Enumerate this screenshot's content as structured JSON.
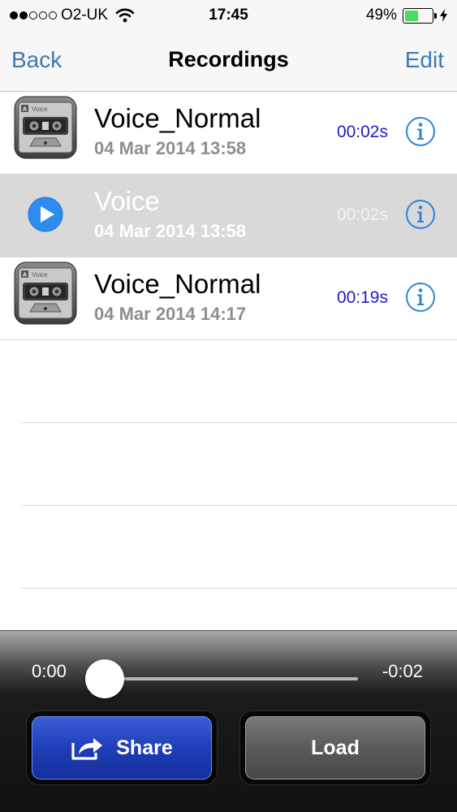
{
  "status_bar": {
    "carrier": "O2-UK",
    "time": "17:45",
    "battery_percent": "49%",
    "battery_level": 0.49,
    "signal_strength": 2,
    "signal_max": 5,
    "battery_color": "#4cd964"
  },
  "nav": {
    "back_label": "Back",
    "title": "Recordings",
    "edit_label": "Edit",
    "tint_color": "#3d7ab0"
  },
  "recordings": [
    {
      "title": "Voice_Normal",
      "date": "04 Mar 2014 13:58",
      "duration": "00:02s",
      "icon": "cassette-icon",
      "selected": false
    },
    {
      "title": "Voice",
      "date": "04 Mar 2014 13:58",
      "duration": "00:02s",
      "icon": "play-icon",
      "selected": true
    },
    {
      "title": "Voice_Normal",
      "date": "04 Mar 2014 14:17",
      "duration": "00:19s",
      "icon": "cassette-icon",
      "selected": false
    }
  ],
  "cassette_label": "Voice",
  "player": {
    "elapsed": "0:00",
    "remaining": "-0:02",
    "progress": 0.0,
    "share_label": "Share",
    "load_label": "Load"
  },
  "icons": {
    "info": "info-icon",
    "share": "share-arrow-icon",
    "wifi": "wifi-icon",
    "battery": "battery-icon",
    "charging": "bolt-icon"
  }
}
